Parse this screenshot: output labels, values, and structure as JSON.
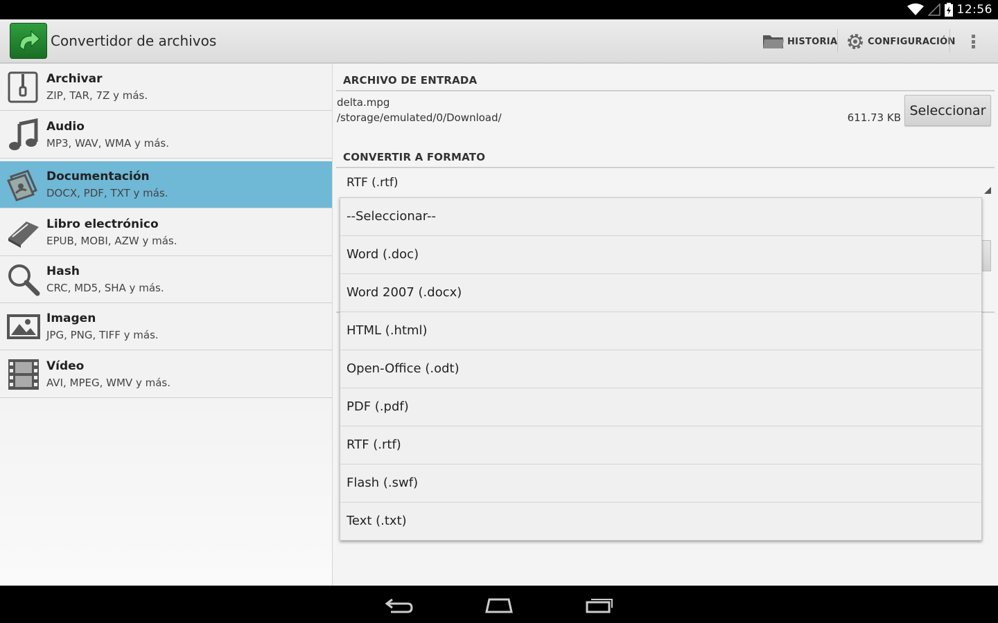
{
  "status_bar": {
    "time": "12:56"
  },
  "action_bar": {
    "title": "Convertidor de archivos",
    "history_label": "HISTORIA",
    "settings_label": "CONFIGURACIÓN"
  },
  "sidebar": {
    "items": [
      {
        "title": "Archivar",
        "subtitle": "ZIP, TAR, 7Z y más.",
        "icon": "archive-icon"
      },
      {
        "title": "Audio",
        "subtitle": "MP3, WAV, WMA y más.",
        "icon": "music-note-icon"
      },
      {
        "title": "Documentación",
        "subtitle": "DOCX, PDF, TXT y más.",
        "icon": "document-icon",
        "selected": true
      },
      {
        "title": "Libro electrónico",
        "subtitle": "EPUB, MOBI, AZW y más.",
        "icon": "book-icon"
      },
      {
        "title": "Hash",
        "subtitle": "CRC, MD5, SHA y más.",
        "icon": "magnifier-icon"
      },
      {
        "title": "Imagen",
        "subtitle": "JPG, PNG, TIFF y más.",
        "icon": "image-icon"
      },
      {
        "title": "Vídeo",
        "subtitle": "AVI, MPEG, WMV y más.",
        "icon": "film-icon"
      }
    ]
  },
  "main": {
    "input_header": "ARCHIVO DE ENTRADA",
    "file_name": "delta.mpg",
    "file_path": "/storage/emulated/0/Download/",
    "file_size": "611.73 KB",
    "select_button": "Seleccionar",
    "format_header": "CONVERTIR A FORMATO",
    "selected_format": "RTF (.rtf)"
  },
  "dropdown": {
    "options": [
      "--Seleccionar--",
      "Word (.doc)",
      "Word 2007 (.docx)",
      "HTML (.html)",
      "Open-Office (.odt)",
      "PDF (.pdf)",
      "RTF (.rtf)",
      "Flash (.swf)",
      "Text (.txt)"
    ]
  },
  "colors": {
    "selected_item": "#6fb8d6",
    "app_icon": "#2e9e3e",
    "status_bar": "#000000"
  }
}
